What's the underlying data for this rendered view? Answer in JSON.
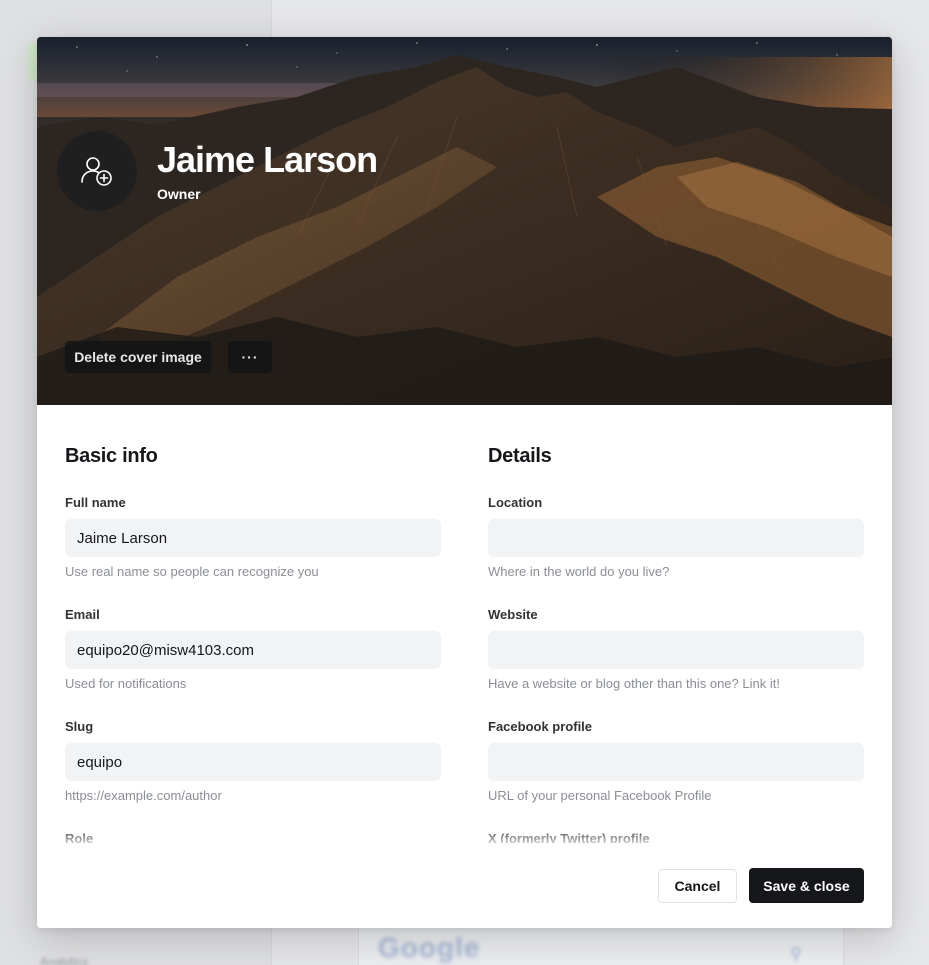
{
  "background": {
    "google_text": "Google",
    "sidebar_items": [
      "Analytics"
    ]
  },
  "profile": {
    "name": "Jaime Larson",
    "role": "Owner"
  },
  "cover": {
    "delete_label": "Delete cover image",
    "more_label": "···"
  },
  "basic_info": {
    "title": "Basic info",
    "fields": [
      {
        "label": "Full name",
        "value": "Jaime Larson",
        "placeholder": "",
        "hint": "Use real name so people can recognize you"
      },
      {
        "label": "Email",
        "value": "equipo20@misw4103.com",
        "placeholder": "",
        "hint": "Used for notifications"
      },
      {
        "label": "Slug",
        "value": "equipo",
        "placeholder": "",
        "hint": "https://example.com/author"
      },
      {
        "label": "Role",
        "value": "",
        "placeholder": "",
        "hint": ""
      }
    ]
  },
  "details": {
    "title": "Details",
    "fields": [
      {
        "label": "Location",
        "value": "",
        "placeholder": "",
        "hint": "Where in the world do you live?"
      },
      {
        "label": "Website",
        "value": "",
        "placeholder": "",
        "hint": "Have a website or blog other than this one? Link it!"
      },
      {
        "label": "Facebook profile",
        "value": "",
        "placeholder": "",
        "hint": "URL of your personal Facebook Profile"
      },
      {
        "label": "X (formerly Twitter) profile",
        "value": "",
        "placeholder": "",
        "hint": ""
      }
    ]
  },
  "footer": {
    "cancel_label": "Cancel",
    "save_label": "Save & close"
  },
  "colors": {
    "primary_button": "#15171a",
    "input_bg": "#f2f3f5",
    "hint_text": "#8a8e93"
  }
}
